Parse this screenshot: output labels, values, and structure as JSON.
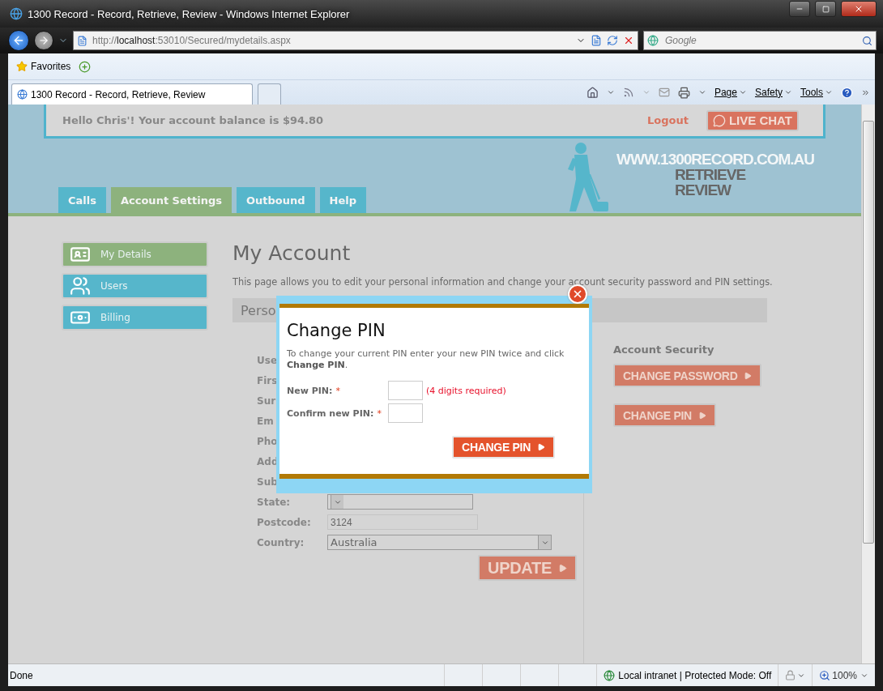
{
  "window": {
    "title": "1300 Record - Record, Retrieve, Review - Windows Internet Explorer"
  },
  "address_bar": {
    "url": "http://**localhost**:53010/Secured/mydetails.aspx"
  },
  "search": {
    "placeholder": "Google"
  },
  "favorites_bar": {
    "label": "Favorites"
  },
  "browser_tabs": [
    {
      "label": "1300 Record - Record, Retrieve, Review",
      "selected": true
    }
  ],
  "command_bar": [
    "Page",
    "Safety",
    "Tools"
  ],
  "page": {
    "greeting": "Hello Chris'! Your account balance is $94.80",
    "logout": "Logout",
    "live_chat": "LIVE CHAT",
    "logo": [
      "WWW.1300RECORD.COM.AU",
      "RETRIEVE",
      "REVIEW"
    ],
    "nav_tabs": [
      {
        "label": "Calls",
        "selected": false
      },
      {
        "label": "Account Settings",
        "selected": true
      },
      {
        "label": "Outbound",
        "selected": false
      },
      {
        "label": "Help",
        "selected": false
      }
    ],
    "sidebar": [
      {
        "label": "My Details",
        "selected": true,
        "kind": "card"
      },
      {
        "label": "Users",
        "selected": false,
        "kind": "users"
      },
      {
        "label": "Billing",
        "selected": false,
        "kind": "money"
      }
    ],
    "heading": "My Account",
    "intro": "This page allows you to edit your personal information and change your account security password and PIN settings.",
    "section_title": "Perso",
    "fields": [
      {
        "label": "Use",
        "kind": "covered"
      },
      {
        "label": "Firs",
        "kind": "covered"
      },
      {
        "label": "Sur",
        "kind": "covered"
      },
      {
        "label": "Em",
        "kind": "covered"
      },
      {
        "label": "Pho",
        "kind": "covered"
      },
      {
        "label": "Add",
        "kind": "covered"
      },
      {
        "label": "Sub",
        "kind": "covered"
      },
      {
        "label": "State:",
        "kind": "select"
      },
      {
        "label": "Postcode:",
        "kind": "text",
        "value": "3124"
      },
      {
        "label": "Country:",
        "kind": "select",
        "value": "Australia"
      }
    ],
    "update_button": "UPDATE",
    "security": {
      "title": "Account Security",
      "buttons": [
        "CHANGE PASSWORD",
        "CHANGE PIN"
      ]
    }
  },
  "dialog": {
    "title": "Change PIN",
    "text": "To change your current PIN enter your new PIN twice and click **Change PIN**.",
    "fields": [
      {
        "label": "New PIN:",
        "required_mark": "*",
        "hint": "(4 digits required)"
      },
      {
        "label": "Confirm new PIN:",
        "required_mark": "*"
      }
    ],
    "button": "CHANGE PIN"
  },
  "status_bar": {
    "text": "Done",
    "zone": "Local intranet | Protected Mode: Off",
    "zoom": "100%"
  }
}
